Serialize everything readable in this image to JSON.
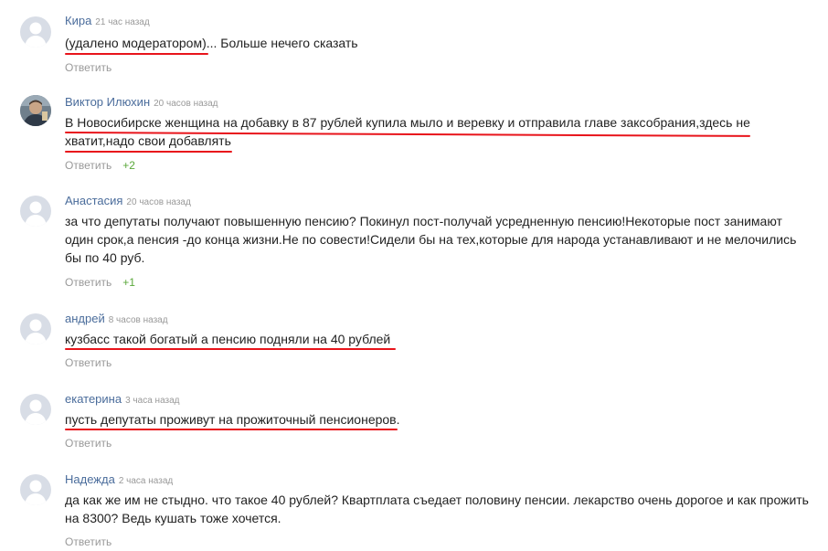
{
  "reply_label": "Ответить",
  "colors": {
    "author": "#4a6c9b",
    "time": "#999999",
    "votes": "#5aa83a",
    "underline": "#e8141b"
  },
  "comments": [
    {
      "author": "Кира",
      "time": "21 час назад",
      "text": "(удалено модератором)... Больше нечего сказать",
      "votes": "",
      "avatar": "default-avatar-icon"
    },
    {
      "author": "Виктор Илюхин",
      "time": "20 часов назад",
      "text": "В Новосибирске женщина на добавку в 87 рублей купила мыло и веревку и отправила главе заксобрания,здесь не хватит,надо свои добавлять",
      "votes": "+2",
      "avatar": "user-photo"
    },
    {
      "author": "Анастасия",
      "time": "20 часов назад",
      "text": "за что депутаты получают повышенную пенсию? Покинул пост-получай усредненную пенсию!Некоторые пост занимают один срок,а пенсия -до конца жизни.Не по совести!Сидели бы на тех,которые для народа устанавливают и не мелочились бы по 40 руб.",
      "votes": "+1",
      "avatar": "default-avatar-icon"
    },
    {
      "author": "андрей",
      "time": "8 часов назад",
      "text": "кузбасс такой богатый а пенсию подняли на 40 рублей",
      "votes": "",
      "avatar": "default-avatar-icon"
    },
    {
      "author": "екатерина",
      "time": "3 часа назад",
      "text": "пусть депутаты проживут на прожиточный пенсионеров.",
      "votes": "",
      "avatar": "default-avatar-icon"
    },
    {
      "author": "Надежда",
      "time": "2 часа назад",
      "text": "да как же им не стыдно. что такое 40 рублей? Квартплата съедает половину пенсии. лекарство очень дорогое и как прожить на 8300? Ведь кушать тоже хочется.",
      "votes": "",
      "avatar": "default-avatar-icon"
    }
  ]
}
